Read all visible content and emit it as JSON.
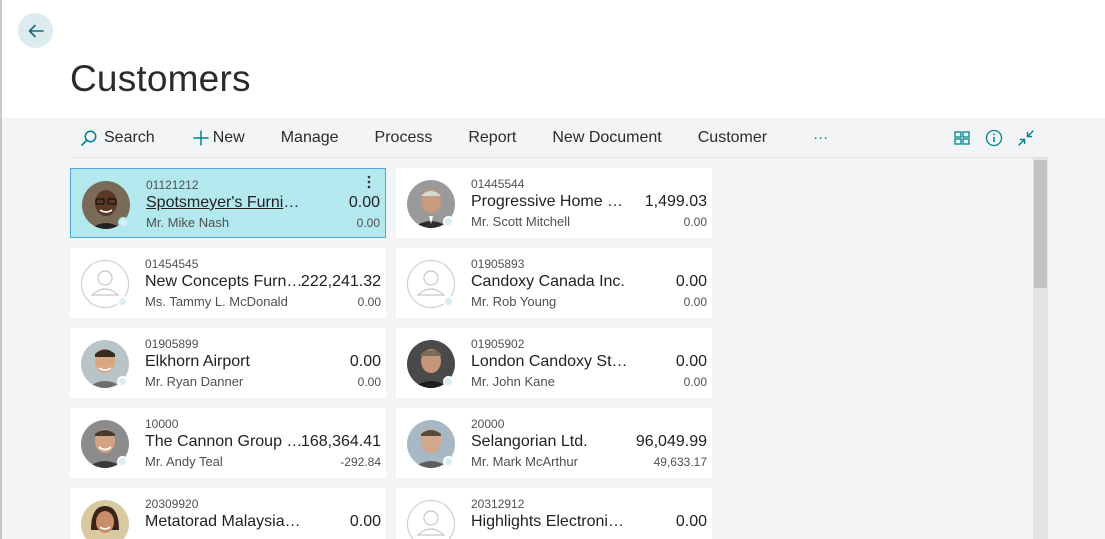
{
  "page": {
    "title": "Customers"
  },
  "toolbar": {
    "search": "Search",
    "new": "New",
    "manage": "Manage",
    "process": "Process",
    "report": "Report",
    "new_document": "New Document",
    "customer": "Customer",
    "more": "···"
  },
  "colors": {
    "accent": "#00838f",
    "selected_card": "#b3e8ee",
    "selected_border": "#4fa8d4"
  },
  "customers": [
    {
      "no": "01121212",
      "name": "Spotsmeyer's Furnishings",
      "balance": "0.00",
      "contact": "Mr. Mike Nash",
      "balance_due": "0.00",
      "photo": "dark-skinned man with glasses"
    },
    {
      "no": "01445544",
      "name": "Progressive Home Furn...",
      "balance": "1,499.03",
      "contact": "Mr. Scott Mitchell",
      "balance_due": "0.00",
      "photo": "gray-haired man"
    },
    {
      "no": "01454545",
      "name": "New Concepts Furnit...",
      "balance": "222,241.32",
      "contact": "Ms. Tammy L. McDonald",
      "balance_due": "0.00",
      "photo": "blank"
    },
    {
      "no": "01905893",
      "name": "Candoxy Canada Inc.",
      "balance": "0.00",
      "contact": "Mr. Rob Young",
      "balance_due": "0.00",
      "photo": "blank"
    },
    {
      "no": "01905899",
      "name": "Elkhorn Airport",
      "balance": "0.00",
      "contact": "Mr. Ryan Danner",
      "balance_due": "0.00",
      "photo": "young man"
    },
    {
      "no": "01905902",
      "name": "London Candoxy Storage C...",
      "balance": "0.00",
      "contact": "Mr. John Kane",
      "balance_due": "0.00",
      "photo": "man in dark shirt"
    },
    {
      "no": "10000",
      "name": "The Cannon Group P...",
      "balance": "168,364.41",
      "contact": "Mr. Andy Teal",
      "balance_due": "-292.84",
      "photo": "smiling man"
    },
    {
      "no": "20000",
      "name": "Selangorian Ltd.",
      "balance": "96,049.99",
      "contact": "Mr. Mark McArthur",
      "balance_due": "49,633.17",
      "photo": "man outdoors"
    },
    {
      "no": "20309920",
      "name": "Metatorad Malaysia Sdn Bhd",
      "balance": "0.00",
      "contact": "",
      "balance_due": "",
      "photo": "woman"
    },
    {
      "no": "20312912",
      "name": "Highlights Electronics Sdn ...",
      "balance": "0.00",
      "contact": "",
      "balance_due": "",
      "photo": "blank"
    }
  ]
}
